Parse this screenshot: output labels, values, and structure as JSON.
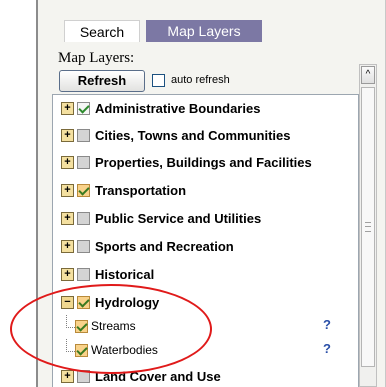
{
  "tabs": [
    {
      "label": "Search",
      "active": false
    },
    {
      "label": "Map Layers",
      "active": true
    }
  ],
  "panel_title": "Map Layers:",
  "refresh_label": "Refresh",
  "auto_refresh_label": "auto refresh",
  "auto_refresh_checked": false,
  "help_icon_glyph": "?",
  "scroll_up_glyph": "^",
  "layers": [
    {
      "label": "Administrative Boundaries",
      "expander": "+",
      "checked": true
    },
    {
      "label": "Cities, Towns and Communities",
      "expander": "+",
      "checked": false
    },
    {
      "label": "Properties, Buildings and Facilities",
      "expander": "+",
      "checked": false
    },
    {
      "label": "Transportation",
      "expander": "+",
      "checked": true
    },
    {
      "label": "Public Service and Utilities",
      "expander": "+",
      "checked": false
    },
    {
      "label": "Sports and Recreation",
      "expander": "+",
      "checked": false
    },
    {
      "label": "Historical",
      "expander": "+",
      "checked": false
    },
    {
      "label": "Hydrology",
      "expander": "−",
      "checked": true,
      "children": [
        {
          "label": "Streams",
          "checked": true
        },
        {
          "label": "Waterbodies",
          "checked": true
        }
      ]
    },
    {
      "label": "Land Cover and Use",
      "expander": "+",
      "checked": false
    }
  ],
  "colors": {
    "active_tab": "#7c78a4",
    "annotation": "#e01a1a",
    "help_icon": "#2a4fa8"
  }
}
